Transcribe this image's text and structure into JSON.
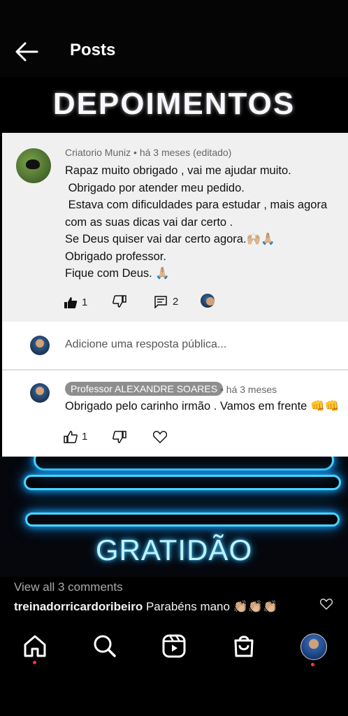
{
  "header": {
    "title": "Posts"
  },
  "post_image": {
    "heading": "DEPOIMENTOS",
    "footer_text": "GRATIDÃO",
    "comment": {
      "author": "Criatorio Muniz",
      "meta": "Criatorio Muniz • há 3 meses (editado)",
      "text": "Rapaz muito obrigado , vai me ajudar muito.\n Obrigado por atender meu pedido.\n Estava com dificuldades para estudar , mais agora com as suas dicas vai dar certo .\nSe Deus quiser vai dar certo agora.🙌🏼🙏🏼\nObrigado professor.\nFique com Deus. 🙏🏼",
      "likes": "1",
      "replies": "2"
    },
    "reply_placeholder": "Adicione uma resposta pública...",
    "reply": {
      "author": "Professor ALEXANDRE SOARES",
      "time": "• há 3 meses",
      "text": "Obrigado pelo carinho irmão . Vamos em frente 👊👊",
      "likes": "1"
    }
  },
  "comments": {
    "view_all": "View all 3 comments",
    "first_author": "treinadorricardoribeiro",
    "first_text": " Parabéns mano 👏🏼👏🏼👏🏼"
  },
  "nav": {
    "items": [
      "home-icon",
      "search-icon",
      "reels-icon",
      "shop-icon",
      "profile-avatar"
    ],
    "accent": "#ff3040"
  }
}
